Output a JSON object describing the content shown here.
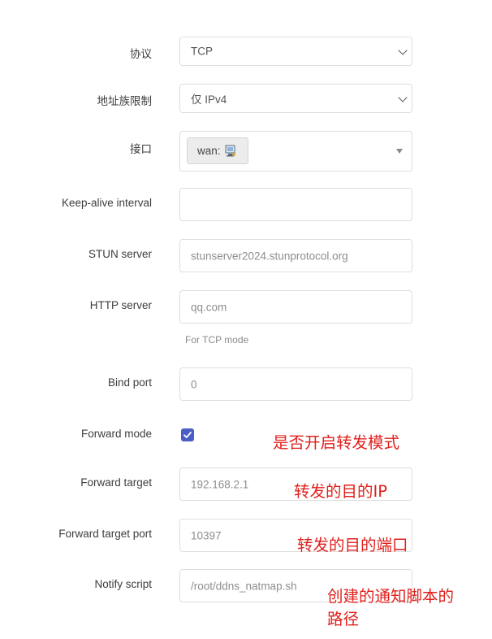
{
  "form": {
    "protocol": {
      "label": "协议",
      "value": "TCP"
    },
    "family": {
      "label": "地址族限制",
      "value": "仅 IPv4"
    },
    "interface": {
      "label": "接口",
      "chip": "wan:",
      "chip_icon": "network-interface-icon"
    },
    "keepalive": {
      "label": "Keep-alive interval",
      "value": ""
    },
    "stun": {
      "label": "STUN server",
      "placeholder": "stunserver2024.stunprotocol.org"
    },
    "http": {
      "label": "HTTP server",
      "placeholder": "qq.com",
      "hint": "For TCP mode"
    },
    "bind_port": {
      "label": "Bind port",
      "placeholder": "0"
    },
    "forward_mode": {
      "label": "Forward mode",
      "checked": true
    },
    "forward_target": {
      "label": "Forward target",
      "placeholder": "192.168.2.1"
    },
    "forward_port": {
      "label": "Forward target port",
      "placeholder": "10397"
    },
    "notify_script": {
      "label": "Notify script",
      "placeholder": "/root/ddns_natmap.sh"
    }
  },
  "annotations": {
    "forward_mode": "是否开启转发模式",
    "forward_target": "转发的目的IP",
    "forward_port": "转发的目的端口",
    "notify_line1": "创建的通知脚本的",
    "notify_line2": "路径"
  },
  "colors": {
    "annotation": "#e0201c",
    "checkbox": "#4a5fc5",
    "border": "#dedede"
  }
}
